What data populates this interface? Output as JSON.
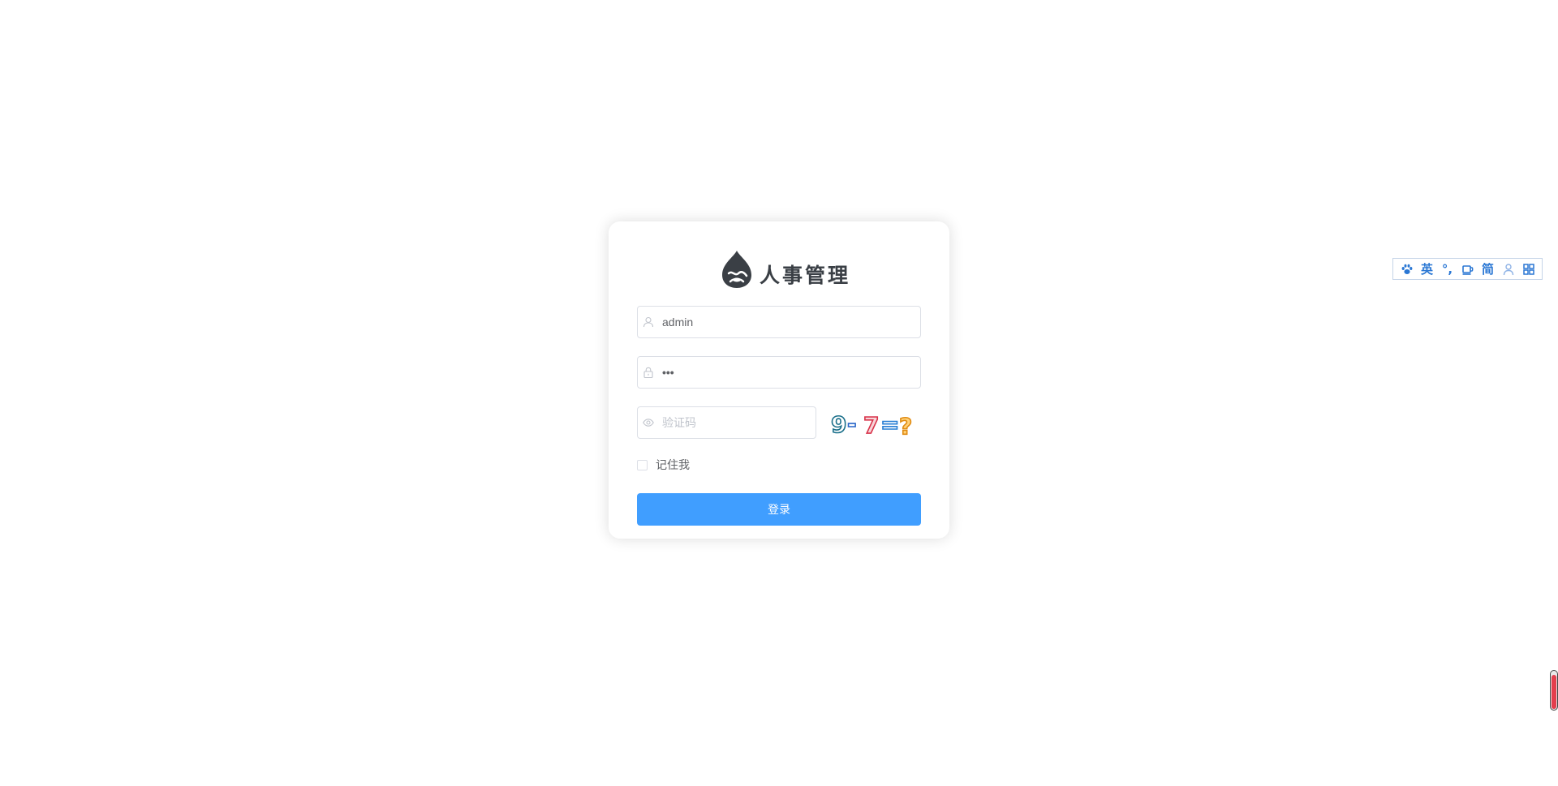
{
  "login": {
    "logo_text": "人事管理",
    "username": {
      "value": "admin",
      "placeholder": "",
      "icon": "user-icon"
    },
    "password": {
      "value": "•••",
      "placeholder": "",
      "icon": "lock-icon"
    },
    "captcha": {
      "value": "",
      "placeholder": "验证码",
      "icon": "eye-icon",
      "image_text": "9-7=?"
    },
    "remember_label": "记住我",
    "remember_checked": false,
    "submit_label": "登录"
  },
  "ime_toolbar": {
    "items": [
      {
        "name": "paw-icon",
        "label": ""
      },
      {
        "name": "lang-toggle",
        "label": "英"
      },
      {
        "name": "punctuation-icon",
        "label": "°,"
      },
      {
        "name": "cup-icon",
        "label": ""
      },
      {
        "name": "script-toggle",
        "label": "简"
      },
      {
        "name": "user-icon",
        "label": ""
      },
      {
        "name": "grid-icon",
        "label": ""
      }
    ]
  },
  "edge_widget": {
    "level": 0.92,
    "color": "#e33e4d"
  },
  "colors": {
    "primary": "#409eff",
    "ime_accent": "#2a77d4",
    "logo_dark": "#3a3f45"
  }
}
